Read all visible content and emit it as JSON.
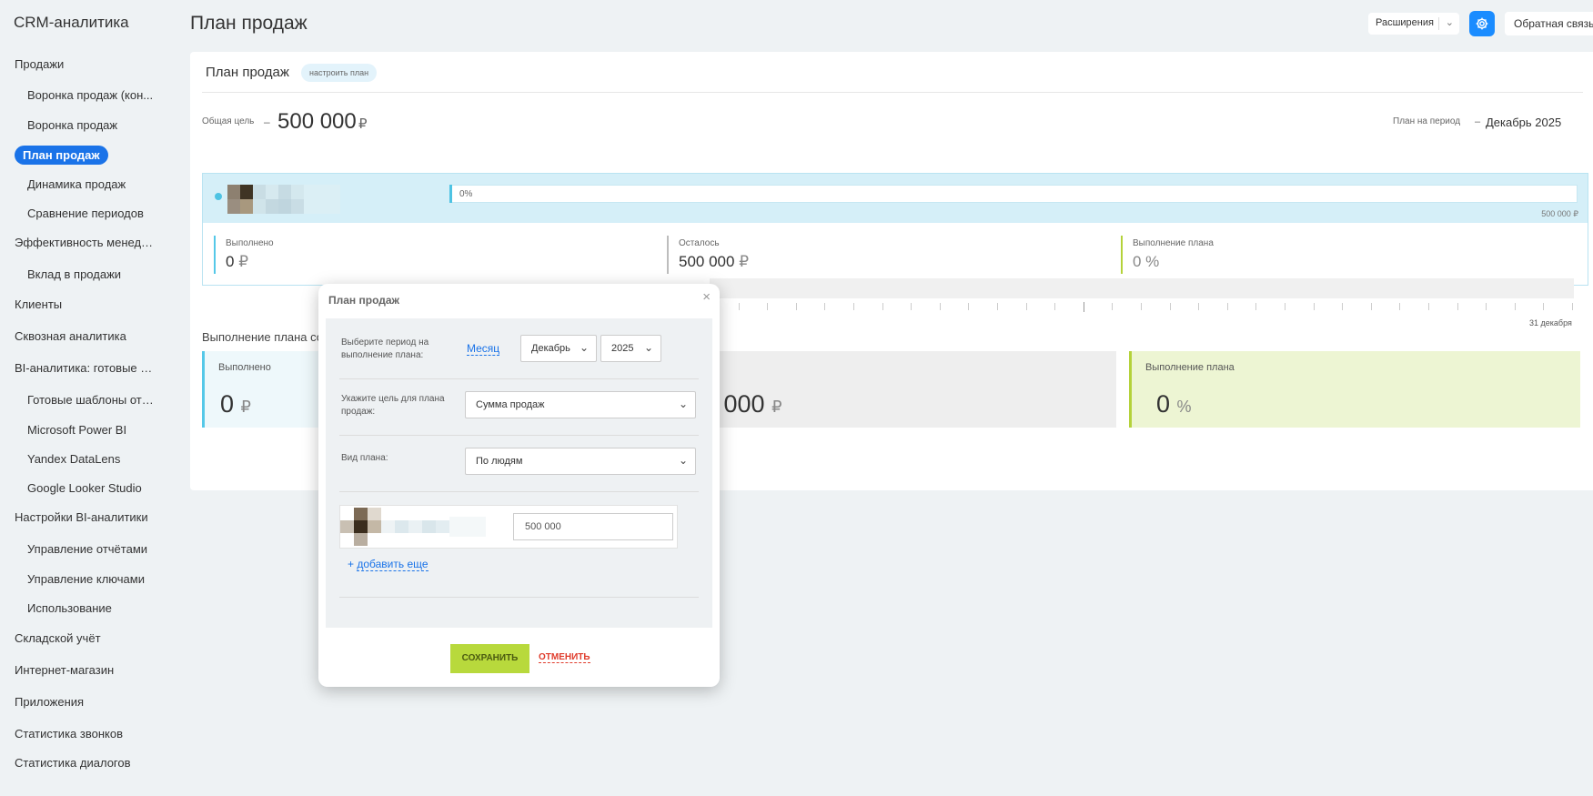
{
  "app": {
    "title": "CRM-аналитика"
  },
  "sidebar": {
    "items": [
      {
        "label": "Продажи",
        "level": 0
      },
      {
        "label": "Воронка продаж (кон...",
        "level": 1
      },
      {
        "label": "Воронка продаж",
        "level": 1
      },
      {
        "label": "План продаж",
        "level": 1,
        "active": true
      },
      {
        "label": "Динамика продаж",
        "level": 1
      },
      {
        "label": "Сравнение периодов",
        "level": 1
      },
      {
        "label": "Эффективность менедже...",
        "level": 0
      },
      {
        "label": "Вклад в продажи",
        "level": 1
      },
      {
        "label": "Клиенты",
        "level": 0
      },
      {
        "label": "Сквозная аналитика",
        "level": 0
      },
      {
        "label": "BI-аналитика: готовые от...",
        "level": 0
      },
      {
        "label": "Готовые шаблоны отч...",
        "level": 1
      },
      {
        "label": "Microsoft Power BI",
        "level": 1
      },
      {
        "label": "Yandex DataLens",
        "level": 1
      },
      {
        "label": "Google Looker Studio",
        "level": 1
      },
      {
        "label": "Настройки BI-аналитики",
        "level": 0
      },
      {
        "label": "Управление отчётами",
        "level": 1
      },
      {
        "label": "Управление ключами",
        "level": 1
      },
      {
        "label": "Использование",
        "level": 1
      },
      {
        "label": "Складской учёт",
        "level": 0
      },
      {
        "label": "Интернет-магазин",
        "level": 0
      },
      {
        "label": "Приложения",
        "level": 0
      },
      {
        "label": "Статистика звонков",
        "level": 0
      },
      {
        "label": "Статистика диалогов",
        "level": 0
      }
    ]
  },
  "header": {
    "title": "План продаж",
    "extensions_label": "Расширения",
    "feedback_label": "Обратная связь",
    "accent": "#1a8cff"
  },
  "plan_card": {
    "title": "План продаж",
    "configure_label": "настроить план",
    "goal_label": "Общая цель",
    "dash": "–",
    "goal_value": "500 000",
    "currency": "₽",
    "period_label": "План на период",
    "period_value": "Декабрь 2025",
    "progress_pct_text": "0%",
    "progress_fraction": 0,
    "progress_end": "500 000 ₽",
    "stats": {
      "done_label": "Выполнено",
      "done_value": "0",
      "left_label": "Осталось",
      "left_value": "500 000",
      "plan_label": "Выполнение плана",
      "plan_value": "0 %"
    },
    "chart_label": "Выполнение плана сот",
    "end_date": "31 декабря",
    "kpis": {
      "done_label": "Выполнено",
      "done_value": "0",
      "left_value": "0 000",
      "plan_label": "Выполнение плана",
      "plan_value": "0",
      "percent": "%"
    }
  },
  "modal": {
    "title": "План продаж",
    "close": "×",
    "period_label": "Выберите период на выполнение плана:",
    "period_mode": "Месяц",
    "month": "Декабрь",
    "year": "2025",
    "goal_label": "Укажите цель для плана продаж:",
    "goal_select": "Сумма продаж",
    "type_label": "Вид плана:",
    "type_select": "По людям",
    "amount": "500 000",
    "add_more_plus": "+",
    "add_more": "добавить еще",
    "save": "СОХРАНИТЬ",
    "cancel": "ОТМЕНИТЬ"
  },
  "colors": {
    "active_nav": "#1a73e8",
    "progress_bg": "#d5eff8",
    "save_btn": "#b8d93c",
    "cancel": "#e03c2c",
    "plan_green": "#edf5d3"
  }
}
